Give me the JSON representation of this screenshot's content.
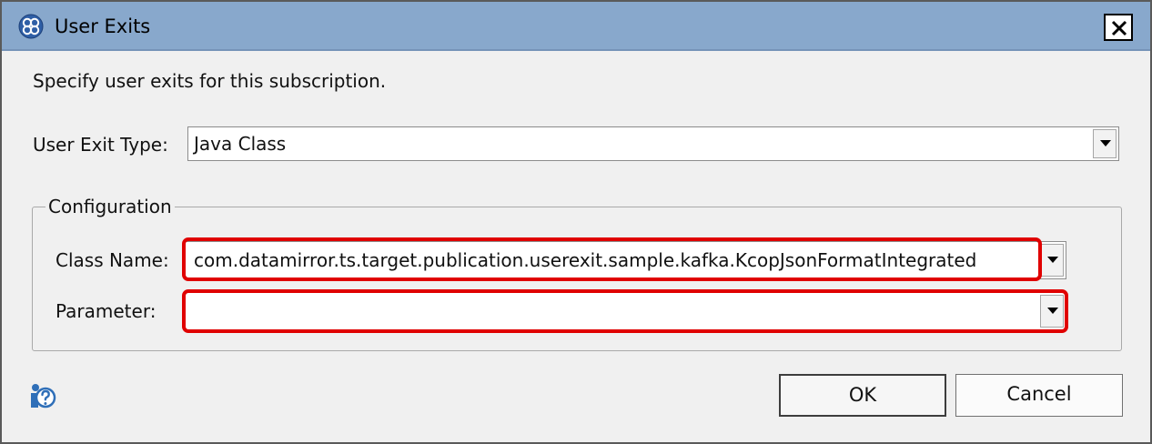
{
  "window": {
    "title": "User Exits",
    "close_label": "X"
  },
  "instructions": "Specify user exits for this subscription.",
  "user_exit_type": {
    "label": "User Exit Type:",
    "value": "Java Class"
  },
  "configuration": {
    "legend": "Configuration",
    "class_name": {
      "label": "Class Name:",
      "value": "com.datamirror.ts.target.publication.userexit.sample.kafka.KcopJsonFormatIntegrated"
    },
    "parameter": {
      "label": "Parameter:",
      "value": ""
    }
  },
  "buttons": {
    "ok": "OK",
    "cancel": "Cancel"
  },
  "colors": {
    "titlebar": "#88a8cc",
    "highlight": "#e00000",
    "dialog_bg": "#f0f0f0"
  },
  "icons": {
    "app": "app-logo-icon",
    "close": "close-icon",
    "dropdown": "chevron-down-icon",
    "help": "help-icon"
  }
}
